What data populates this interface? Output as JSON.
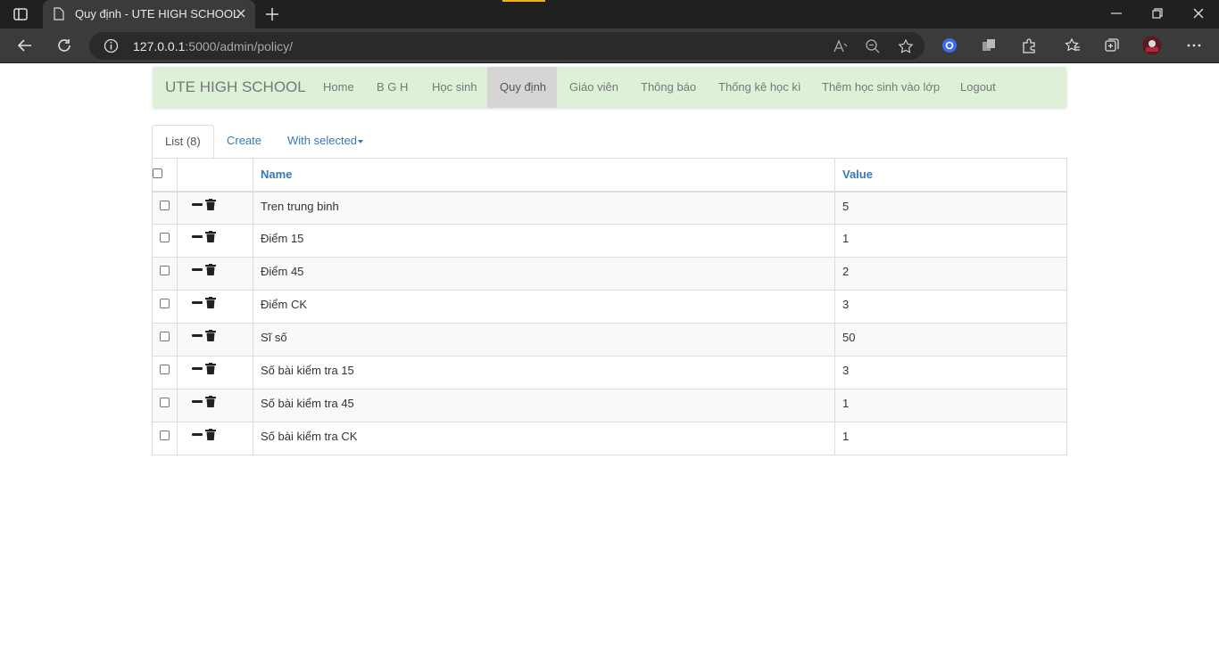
{
  "browser": {
    "tab_title": "Quy định - UTE HIGH SCHOOL",
    "url_host": "127.0.0.1",
    "url_path": ":5000/admin/policy/"
  },
  "navbar": {
    "brand": "UTE HIGH SCHOOL",
    "links": [
      "Home",
      "B G H",
      "Học sinh",
      "Quy định",
      "Giáo viên",
      "Thông báo",
      "Thống kê học kì",
      "Thêm học sinh vào lớp",
      "Logout"
    ],
    "active_index": 3
  },
  "tabs": {
    "list": "List (8)",
    "create": "Create",
    "with_selected": "With selected"
  },
  "table": {
    "columns": [
      "Name",
      "Value"
    ],
    "rows": [
      {
        "name": "Tren trung binh",
        "value": "5"
      },
      {
        "name": "Điểm 15",
        "value": "1"
      },
      {
        "name": "Điểm 45",
        "value": "2"
      },
      {
        "name": "Điểm CK",
        "value": "3"
      },
      {
        "name": "Sĩ số",
        "value": "50"
      },
      {
        "name": "Số bài kiểm tra 15",
        "value": "3"
      },
      {
        "name": "Số bài kiểm tra 45",
        "value": "1"
      },
      {
        "name": "Số bài kiểm tra CK",
        "value": "1"
      }
    ]
  }
}
